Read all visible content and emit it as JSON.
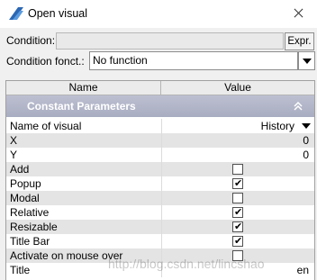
{
  "window": {
    "title": "Open visual",
    "icon": "app-icon",
    "close_icon": "close-icon"
  },
  "condition": {
    "label": "Condition:",
    "value": "",
    "expr_button": "Expr."
  },
  "condition_function": {
    "label": "Condition fonct.:",
    "selected": "No function"
  },
  "grid": {
    "columns": [
      "Name",
      "Value"
    ],
    "section": {
      "title": "Constant Parameters",
      "collapse_icon": "double-chevron-up-icon"
    },
    "rows": [
      {
        "name": "Name of visual",
        "value": "History"
      },
      {
        "name": "X",
        "value": "0"
      },
      {
        "name": "Y",
        "value": "0"
      },
      {
        "name": "Add",
        "checked": false
      },
      {
        "name": "Popup",
        "checked": true
      },
      {
        "name": "Modal",
        "checked": false
      },
      {
        "name": "Relative",
        "checked": true
      },
      {
        "name": "Resizable",
        "checked": true
      },
      {
        "name": "Title Bar",
        "checked": true
      },
      {
        "name": "Activate on mouse over",
        "checked": false
      },
      {
        "name": "Title",
        "value": "en"
      }
    ]
  },
  "watermark": "http://blog.csdn.net/lincshao",
  "colors": {
    "section_header": "#b3b6c9",
    "alt_row": "#e4e4e4",
    "window_bg": "#f0f0f0"
  }
}
